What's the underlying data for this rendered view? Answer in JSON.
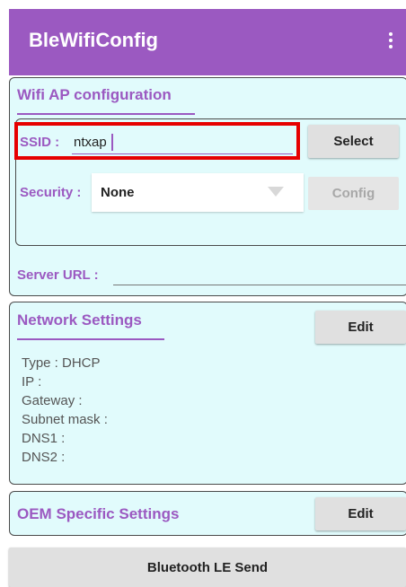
{
  "app": {
    "title": "BleWifiConfig"
  },
  "wifi": {
    "title": "Wifi AP configuration",
    "ssid_label": "SSID :",
    "ssid_value": "ntxap",
    "select_label": "Select",
    "security_label": "Security :",
    "security_value": "None",
    "config_label": "Config"
  },
  "server": {
    "label": "Server URL :",
    "value": ""
  },
  "network": {
    "title": "Network Settings",
    "edit_label": "Edit",
    "lines": [
      "Type : DHCP",
      "IP :",
      "Gateway :",
      "Subnet mask :",
      "DNS1 :",
      "DNS2 :"
    ]
  },
  "oem": {
    "title": "OEM Specific Settings",
    "edit_label": "Edit"
  },
  "send": {
    "label": "Bluetooth LE Send"
  },
  "colors": {
    "accent": "#9b59c1",
    "panel": "#e1fbfc",
    "highlight": "#e60000"
  }
}
